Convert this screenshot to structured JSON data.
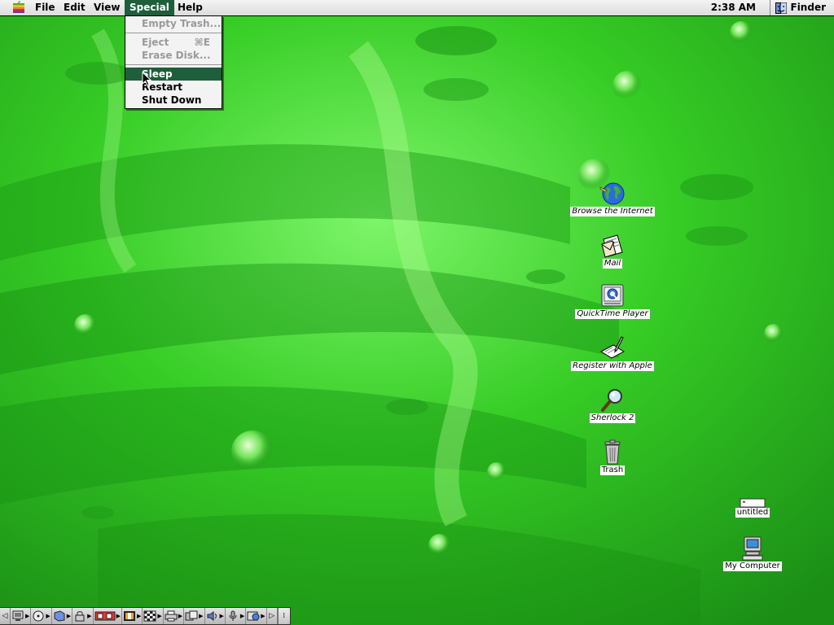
{
  "menubar": {
    "menus": [
      {
        "label": "File"
      },
      {
        "label": "Edit"
      },
      {
        "label": "View"
      },
      {
        "label": "Special"
      },
      {
        "label": "Help"
      }
    ],
    "clock": "2:38 AM",
    "active_app": "Finder"
  },
  "special_menu": {
    "items": [
      {
        "label": "Empty Trash...",
        "enabled": false
      },
      {
        "label": "Eject",
        "shortcut": "⌘E",
        "enabled": false
      },
      {
        "label": "Erase Disk...",
        "enabled": false
      },
      {
        "label": "Sleep",
        "enabled": true,
        "highlighted": true
      },
      {
        "label": "Restart",
        "enabled": true
      },
      {
        "label": "Shut Down",
        "enabled": true
      }
    ]
  },
  "desktop_icons": [
    {
      "label": "Browse the Internet",
      "icon": "globe-icon"
    },
    {
      "label": "Mail",
      "icon": "mail-icon"
    },
    {
      "label": "QuickTime Player",
      "icon": "quicktime-icon"
    },
    {
      "label": "Register with Apple",
      "icon": "register-icon"
    },
    {
      "label": "Sherlock 2",
      "icon": "magnifier-icon"
    },
    {
      "label": "Trash",
      "icon": "trash-icon"
    },
    {
      "label": "untitled",
      "icon": "disk-icon"
    },
    {
      "label": "My Computer",
      "icon": "computer-icon"
    }
  ],
  "colors": {
    "menu_highlight": "#1e5e3a",
    "wallpaper": "#2fbf1f"
  }
}
